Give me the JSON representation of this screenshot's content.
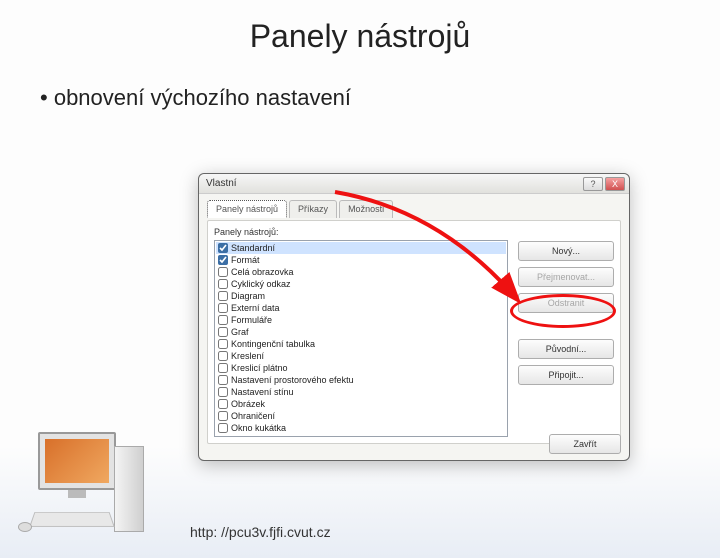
{
  "slide": {
    "title": "Panely nástrojů",
    "bullet": "obnovení výchozího nastavení",
    "footer_url": "http: //pcu3v.fjfi.cvut.cz"
  },
  "dialog": {
    "title": "Vlastní",
    "help_glyph": "?",
    "close_glyph": "X",
    "tabs": {
      "t0": "Panely nástrojů",
      "t1": "Příkazy",
      "t2": "Možnosti"
    },
    "list_label": "Panely nástrojů:",
    "items": {
      "i0": "Standardní",
      "i1": "Formát",
      "i2": "Celá obrazovka",
      "i3": "Cyklický odkaz",
      "i4": "Diagram",
      "i5": "Externí data",
      "i6": "Formuláře",
      "i7": "Graf",
      "i8": "Kontingenční tabulka",
      "i9": "Kreslení",
      "i10": "Kreslicí plátno",
      "i11": "Nastavení prostorového efektu",
      "i12": "Nastavení stínu",
      "i13": "Obrázek",
      "i14": "Ohraničení",
      "i15": "Okno kukátka"
    },
    "buttons": {
      "new": "Nový...",
      "rename": "Přejmenovat...",
      "delete": "Odstranit",
      "reset": "Původní...",
      "attach": "Připojit...",
      "close": "Zavřít"
    }
  }
}
